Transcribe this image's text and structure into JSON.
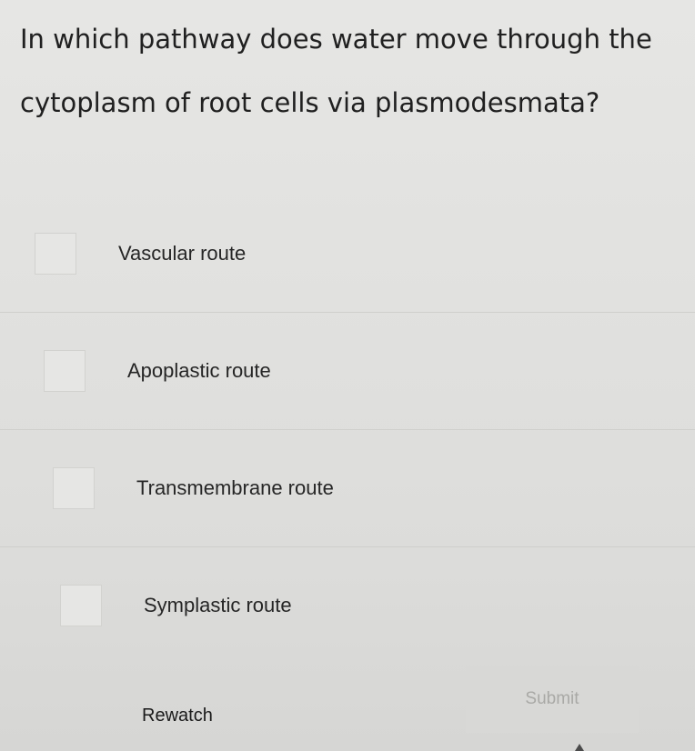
{
  "question": {
    "text": "In which pathway does water move through the cytoplasm of root cells via plasmodesmata?"
  },
  "options": [
    {
      "label": "Vascular route",
      "checked": false
    },
    {
      "label": "Apoplastic route",
      "checked": false
    },
    {
      "label": "Transmembrane route",
      "checked": false
    },
    {
      "label": "Symplastic route",
      "checked": false
    }
  ],
  "footer": {
    "rewatch_label": "Rewatch",
    "submit_label": "Submit",
    "submit_enabled": false
  }
}
